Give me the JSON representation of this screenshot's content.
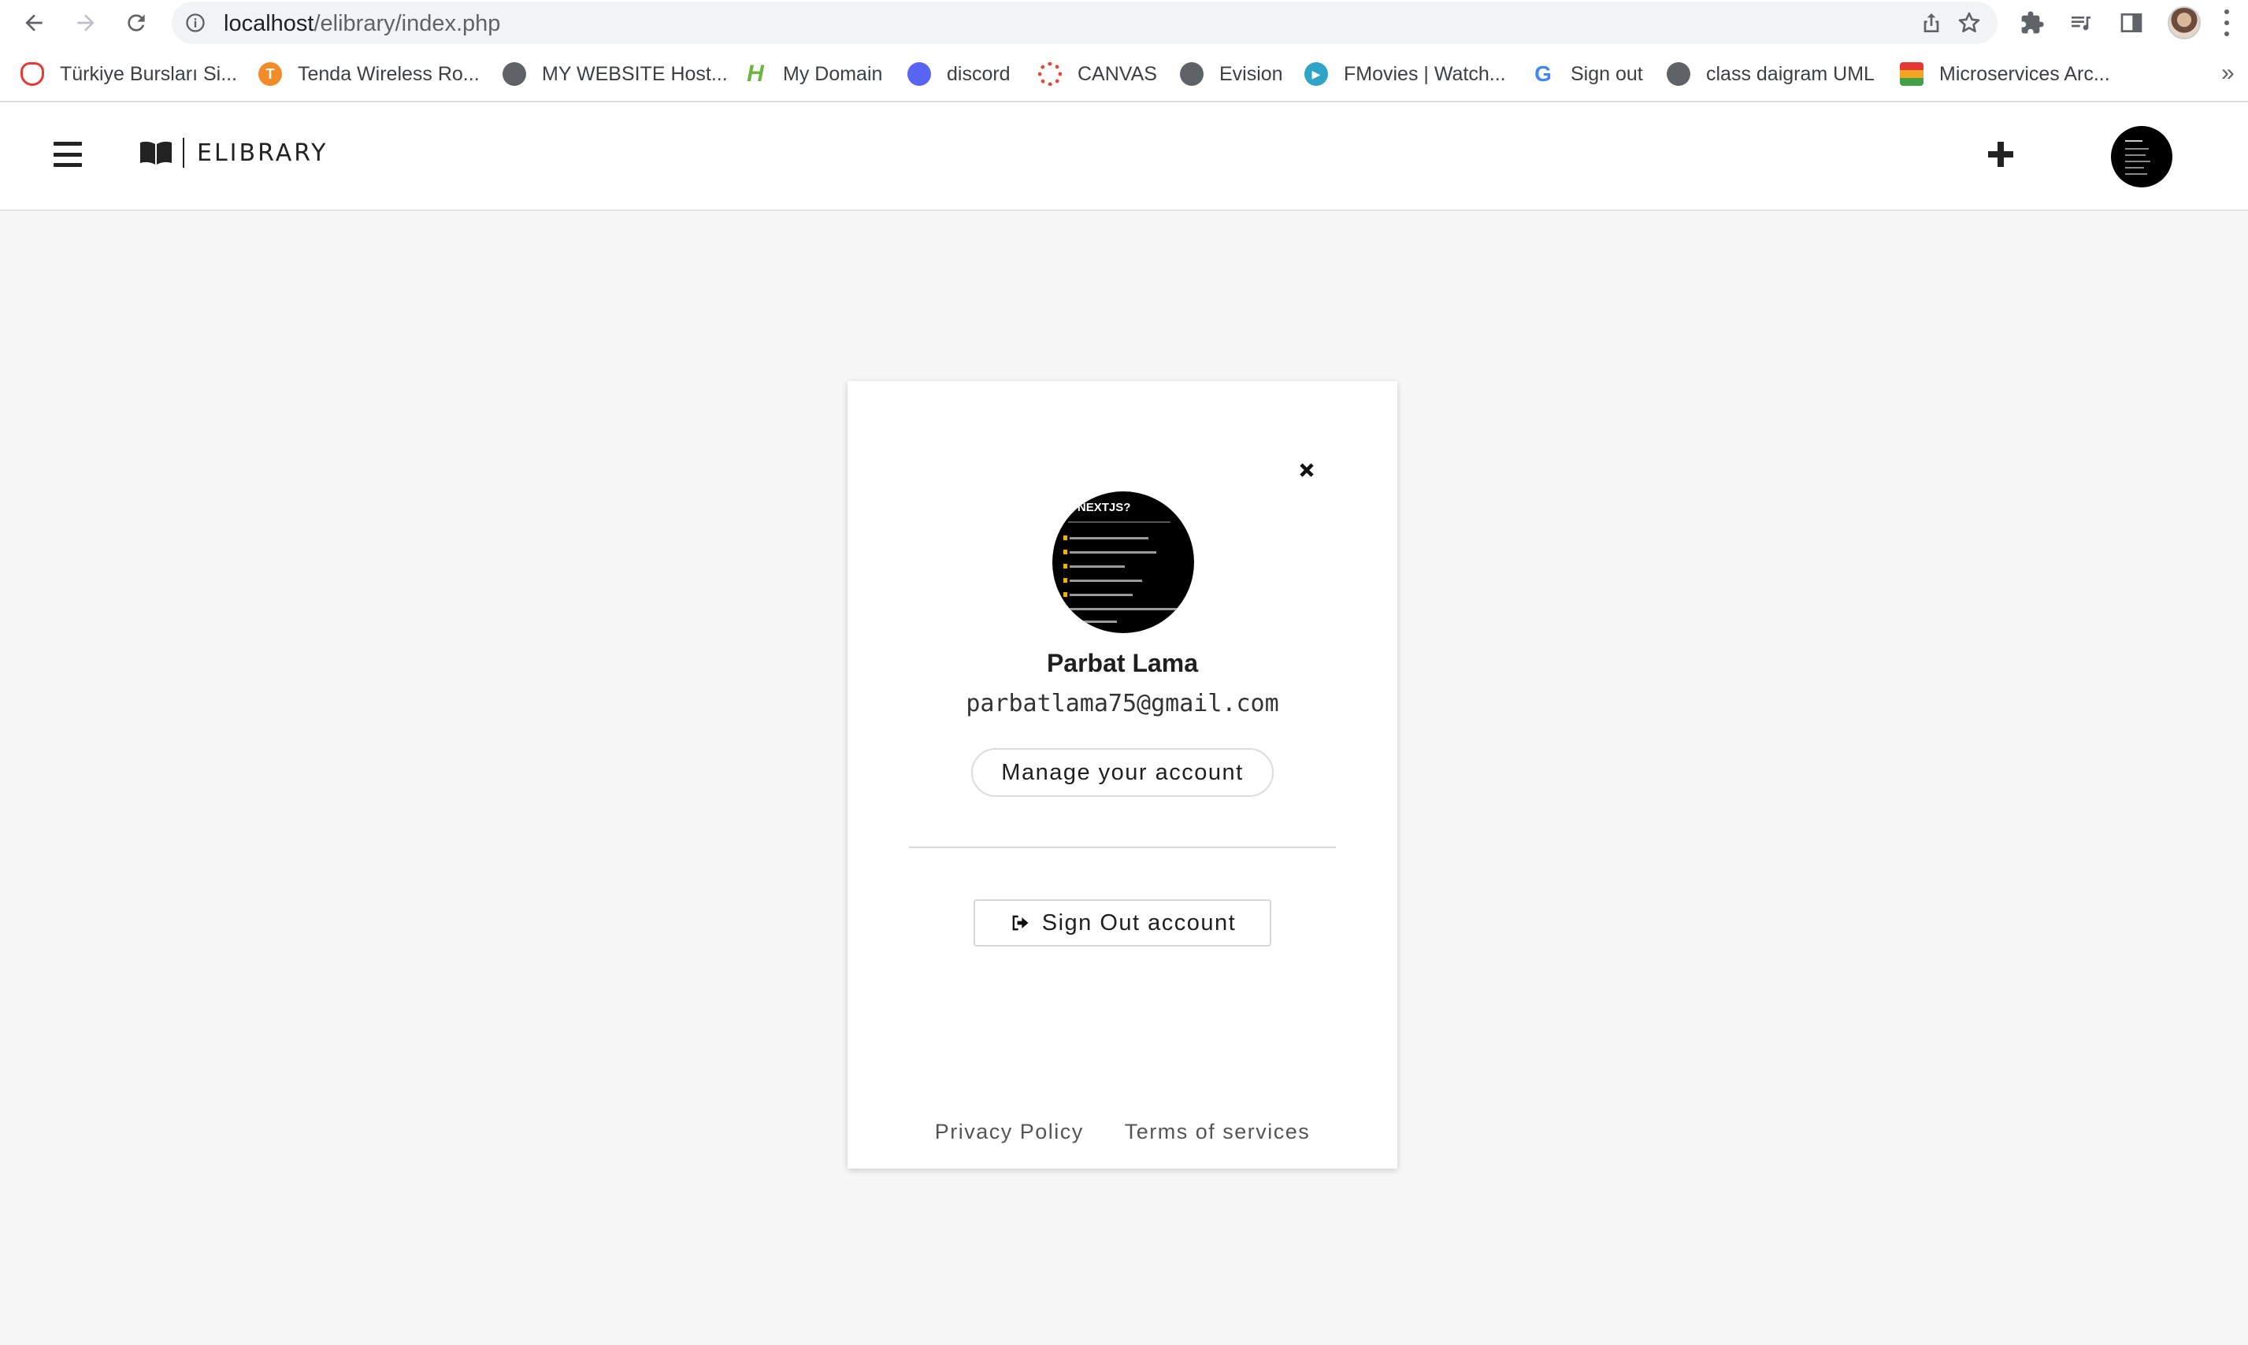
{
  "browser": {
    "url_host": "localhost",
    "url_path": "/elibrary/index.php",
    "bookmarks": [
      {
        "label": "Türkiye Bursları Si...",
        "icon": "turkiye-burslari-icon",
        "color": "#e53935"
      },
      {
        "label": "Tenda Wireless Ro...",
        "icon": "tenda-icon",
        "color": "#f28c28"
      },
      {
        "label": "MY WEBSITE Host...",
        "icon": "globe-icon",
        "color": "#5f6368"
      },
      {
        "label": "My Domain",
        "icon": "h-logo-icon",
        "color": "#6cb33f"
      },
      {
        "label": "discord",
        "icon": "discord-icon",
        "color": "#5865f2"
      },
      {
        "label": "CANVAS",
        "icon": "canvas-icon",
        "color": "#e2483d"
      },
      {
        "label": "Evision",
        "icon": "globe-icon",
        "color": "#5f6368"
      },
      {
        "label": "FMovies | Watch...",
        "icon": "play-icon",
        "color": "#2fa4c7"
      },
      {
        "label": "Sign out",
        "icon": "google-icon",
        "color": "#4285f4"
      },
      {
        "label": "class daigram UML",
        "icon": "globe-icon",
        "color": "#5f6368"
      },
      {
        "label": "Microservices Arc...",
        "icon": "stack-icon",
        "color": "#f4a623"
      }
    ],
    "more_bookmarks": "»"
  },
  "app": {
    "brand": "ELIBRARY"
  },
  "account_card": {
    "avatar_title": "Y NEXTJS?",
    "name": "Parbat Lama",
    "email": "parbatlama75@gmail.com",
    "manage_label": "Manage your account",
    "signout_label": "Sign Out account",
    "footer_links": [
      "Privacy Policy",
      "Terms of services"
    ]
  }
}
